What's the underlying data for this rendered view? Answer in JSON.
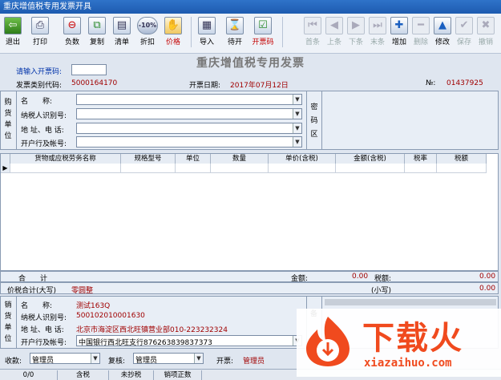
{
  "window": {
    "title": "重庆增值税专用发票开具"
  },
  "toolbar": {
    "left": [
      {
        "label": "退出",
        "icon": "exit-icon"
      },
      {
        "label": "打印",
        "icon": "printer-icon"
      },
      {
        "label": "负数",
        "icon": "minus-icon"
      },
      {
        "label": "复制",
        "icon": "copy-icon"
      },
      {
        "label": "清单",
        "icon": "list-icon"
      },
      {
        "label": "折扣",
        "icon": "discount-icon",
        "badge": "-10%"
      },
      {
        "label": "价格",
        "icon": "price-icon"
      }
    ],
    "middle": [
      {
        "label": "导入",
        "icon": "import-icon"
      },
      {
        "label": "待开",
        "icon": "hourglass-icon"
      },
      {
        "label": "开票码",
        "icon": "invoice-code-icon"
      }
    ],
    "right": [
      {
        "label": "首条",
        "icon": "first-icon",
        "disabled": true
      },
      {
        "label": "上条",
        "icon": "prev-icon",
        "disabled": true
      },
      {
        "label": "下条",
        "icon": "next-icon",
        "disabled": true
      },
      {
        "label": "末条",
        "icon": "last-icon",
        "disabled": true
      },
      {
        "label": "增加",
        "icon": "add-icon",
        "disabled": false
      },
      {
        "label": "删除",
        "icon": "delete-icon",
        "disabled": true
      },
      {
        "label": "修改",
        "icon": "edit-icon",
        "disabled": false
      },
      {
        "label": "保存",
        "icon": "save-icon",
        "disabled": true
      },
      {
        "label": "撤销",
        "icon": "cancel-icon",
        "disabled": true
      }
    ]
  },
  "form": {
    "title": "重庆增值税专用发票",
    "invoice_code_prompt": "请输入开票码:",
    "invoice_type_label": "发票类别代码:",
    "invoice_type_value": "5000164170",
    "date_label": "开票日期:",
    "date_value": "2017年07月12日",
    "no_label": "№:",
    "no_value": "01437925"
  },
  "buyer": {
    "section": [
      "购",
      "货",
      "单",
      "位"
    ],
    "name_label": "名　　称:",
    "tax_id_label": "纳税人识别号:",
    "address_label": "地 址、电 话:",
    "bank_label": "开户行及帐号:",
    "secret_label": [
      "密",
      "码",
      "区"
    ]
  },
  "grid": {
    "headers": [
      "货物或应税劳务名称",
      "规格型号",
      "单位",
      "数量",
      "单价(含税)",
      "金额(含税)",
      "税率",
      "税额"
    ]
  },
  "totals": {
    "sum_label": "合　　计",
    "amount_label": "金额:",
    "amount_value": "0.00",
    "tax_label": "税额:",
    "tax_value": "0.00",
    "total_label": "价税合计(大写)",
    "total_upper": "零圆整",
    "small_label": "(小写)",
    "small_value": "0.00"
  },
  "seller": {
    "section": [
      "销",
      "货",
      "单",
      "位"
    ],
    "name_label": "名　　称:",
    "name_value": "测试163Q",
    "tax_id_label": "纳税人识别号:",
    "tax_id_value": "500102010001630",
    "address_label": "地 址、电 话:",
    "address_value": "北京市海淀区西北旺镇营业部010-223232324",
    "bank_label": "开户行及帐号:",
    "bank_value": "中国银行西北旺支行876263839837373",
    "remark_label": "备"
  },
  "footer": {
    "payee_label": "收款:",
    "payee_value": "管理员",
    "reviewer_label": "复核:",
    "reviewer_value": "管理员",
    "issuer_label": "开票:",
    "issuer_value": "管理员"
  },
  "status": [
    "0/0",
    "含税",
    "未抄税",
    "销项正数"
  ],
  "watermark": {
    "text": "下载火",
    "url": "xiazaihuo.com"
  }
}
